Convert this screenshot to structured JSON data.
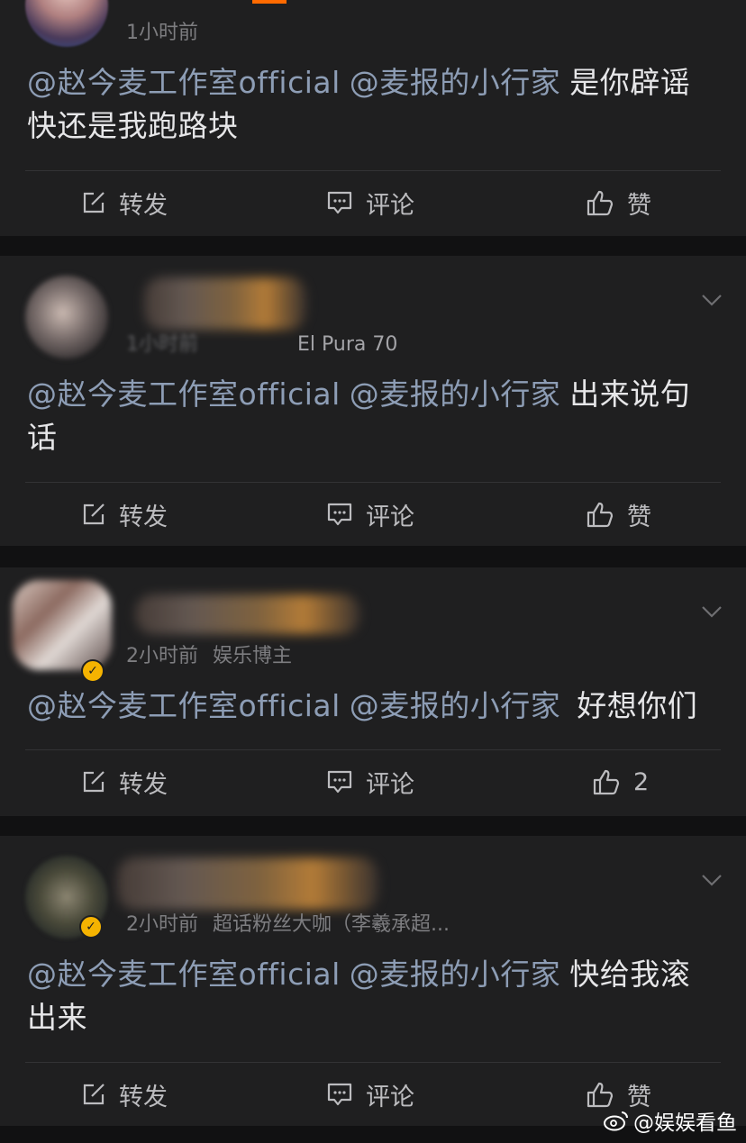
{
  "accent_colors": {
    "mention": "#8d9db5",
    "background": "#111112",
    "card": "#1f1f20",
    "verified": "#f5b301"
  },
  "comments": [
    {
      "time": "1小时前",
      "source": "",
      "verified": false,
      "mentions": [
        "@赵今麦工作室official",
        "@麦报的小行家"
      ],
      "text": "是你辟谣快还是我跑路块",
      "actions": {
        "repost": "转发",
        "comment": "评论",
        "like": "赞"
      }
    },
    {
      "time": "1小时前",
      "source": "El Pura 70",
      "verified": false,
      "mentions": [
        "@赵今麦工作室official",
        "@麦报的小行家"
      ],
      "text": "出来说句话",
      "actions": {
        "repost": "转发",
        "comment": "评论",
        "like": "赞"
      }
    },
    {
      "time": "2小时前",
      "source": "娱乐博主",
      "verified": true,
      "mentions": [
        "@赵今麦工作室official",
        "@麦报的小行家"
      ],
      "text": "好想你们",
      "actions": {
        "repost": "转发",
        "comment": "评论",
        "like": "2"
      }
    },
    {
      "time": "2小时前",
      "source": "超话粉丝大咖（李羲承超...",
      "verified": true,
      "mentions": [
        "@赵今麦工作室official",
        "@麦报的小行家"
      ],
      "text": "快给我滚出来",
      "actions": {
        "repost": "转发",
        "comment": "评论",
        "like": "赞"
      }
    }
  ],
  "watermark": "@娱娱看鱼",
  "icons": {
    "repost": "share-edit-icon",
    "comment": "comment-bubble-icon",
    "like": "thumbs-up-icon",
    "more": "chevron-down-icon",
    "watermark": "weibo-logo-icon"
  }
}
